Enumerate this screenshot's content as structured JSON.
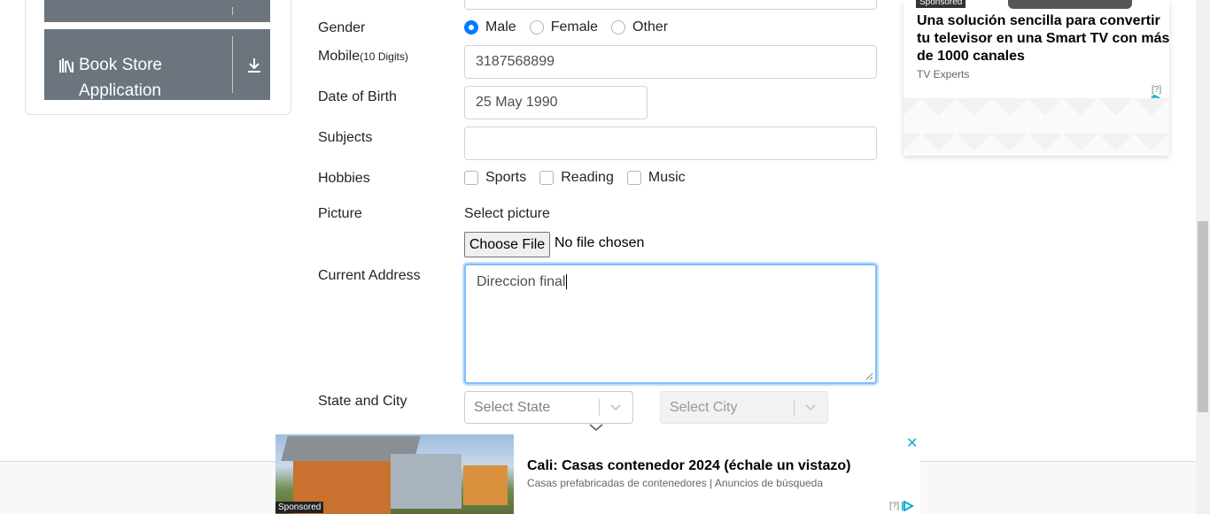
{
  "sidebar": {
    "book_store_label": "Book Store Application"
  },
  "form": {
    "gender": {
      "label": "Gender",
      "options": [
        "Male",
        "Female",
        "Other"
      ],
      "selected": "Male"
    },
    "mobile": {
      "label": "Mobile",
      "hint": "(10 Digits)",
      "value": "3187568899"
    },
    "dob": {
      "label": "Date of Birth",
      "value": "25 May 1990"
    },
    "subjects": {
      "label": "Subjects",
      "value": ""
    },
    "hobbies": {
      "label": "Hobbies",
      "options": [
        "Sports",
        "Reading",
        "Music"
      ]
    },
    "picture": {
      "label": "Picture",
      "select_label": "Select picture",
      "button_label": "Choose File",
      "status": "No file chosen"
    },
    "address": {
      "label": "Current Address",
      "value": "Direccion final"
    },
    "state_city": {
      "label": "State and City",
      "state_placeholder": "Select State",
      "city_placeholder": "Select City"
    }
  },
  "ad_right": {
    "sponsored": "Sponsored",
    "headline": "Una solución sencilla para convertir tu televisor en una Smart TV con más de 1000 canales",
    "source": "TV Experts",
    "mark": "[?]"
  },
  "ad_bottom": {
    "sponsored": "Sponsored",
    "headline": "Cali: Casas contenedor 2024 (échale un vistazo)",
    "sub": "Casas prefabricadas de contenedores | Anuncios de búsqueda",
    "mark": "[?]",
    "close": "✕"
  },
  "colors": {
    "accent": "#007bff",
    "sidebar_item": "#6c757d",
    "ad_close": "#00aecd"
  }
}
